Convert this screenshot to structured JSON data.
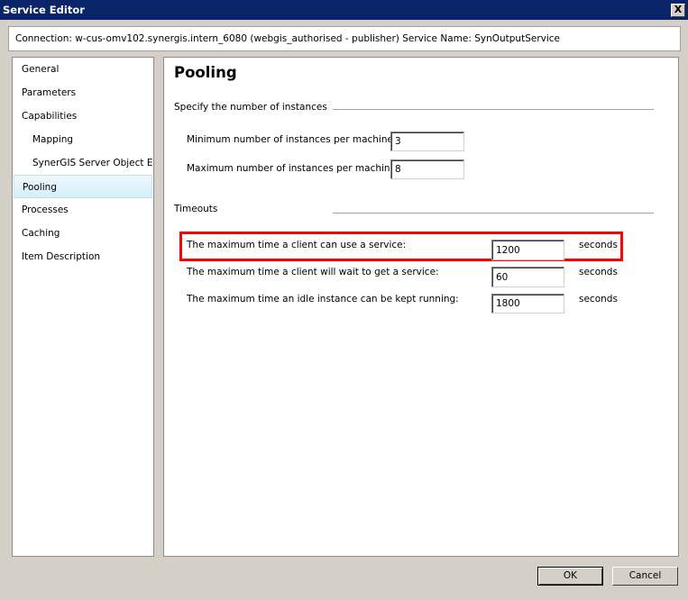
{
  "window": {
    "title": "Service Editor",
    "close_label": "X"
  },
  "connection_text": "Connection: w-cus-omv102.synergis.intern_6080 (webgis_authorised - publisher)   Service Name: SynOutputService",
  "sidebar": {
    "items": [
      {
        "label": "General"
      },
      {
        "label": "Parameters"
      },
      {
        "label": "Capabilities"
      },
      {
        "label": "Mapping"
      },
      {
        "label": "SynerGIS Server Object E"
      },
      {
        "label": "Pooling"
      },
      {
        "label": "Processes"
      },
      {
        "label": "Caching"
      },
      {
        "label": "Item Description"
      }
    ],
    "selected": "Pooling"
  },
  "main": {
    "title": "Pooling",
    "instances": {
      "heading": "Specify the number of instances",
      "min_label": "Minimum number of instances per machine:",
      "min_value": "3",
      "max_label": "Maximum number of instances per machine:",
      "max_value": "8"
    },
    "timeouts": {
      "heading": "Timeouts",
      "rows": [
        {
          "label": "The maximum time a client can use a service:",
          "value": "1200",
          "unit": "seconds"
        },
        {
          "label": "The maximum time a client will wait to get a service:",
          "value": "60",
          "unit": "seconds"
        },
        {
          "label": "The maximum time an idle instance can be kept running:",
          "value": "1800",
          "unit": "seconds"
        }
      ]
    },
    "highlight_color": "#ff0000"
  },
  "buttons": {
    "ok": "OK",
    "cancel": "Cancel"
  }
}
